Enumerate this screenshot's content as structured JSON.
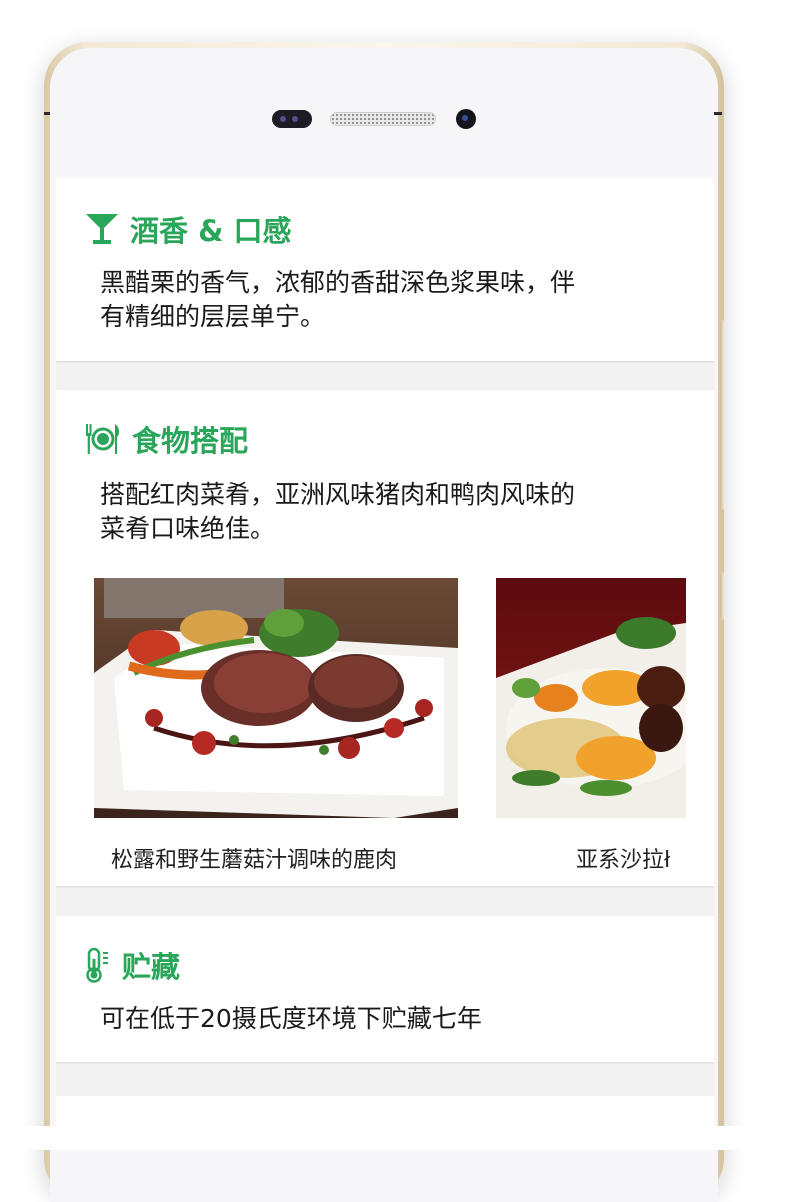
{
  "sections": {
    "tasting": {
      "title": "酒香 & 口感",
      "icon": "cocktail-glass-icon",
      "text_line1": "黑醋栗的香气，浓郁的香甜深色浆果味，伴",
      "text_line2": "有精细的层层单宁。"
    },
    "pairing": {
      "title": "食物搭配",
      "icon": "plate-cutlery-icon",
      "text_line1": "搭配红肉菜肴，亚洲风味猪肉和鸭肉风味的",
      "text_line2": "菜肴口味绝佳。",
      "dishes": [
        {
          "caption": "松露和野生蘑菇汁调味的鹿肉"
        },
        {
          "caption": "亚系沙拉ł"
        }
      ]
    },
    "storage": {
      "title": "贮藏",
      "icon": "thermometer-icon",
      "text": "可在低于20摄氏度环境下贮藏七年"
    }
  },
  "colors": {
    "accent": "#2aa65a",
    "body_text": "#1a1a1a",
    "screen_bg": "#f2f2f2"
  }
}
